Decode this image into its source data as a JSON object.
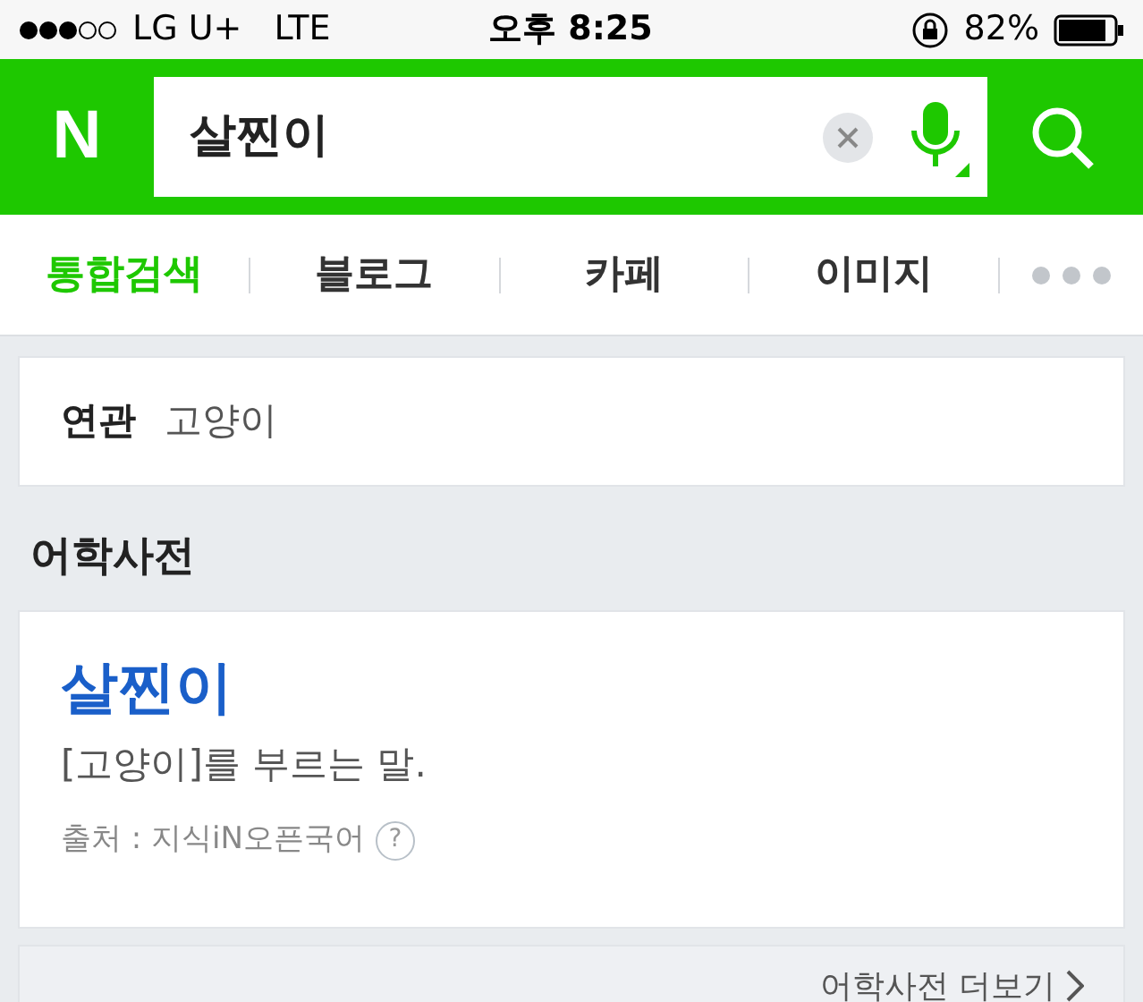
{
  "status_bar": {
    "carrier": "LG U+",
    "network": "LTE",
    "time": "오후 8:25",
    "battery": "82%"
  },
  "search": {
    "logo": "N",
    "query": "살찐이"
  },
  "tabs": [
    {
      "label": "통합검색",
      "selected": true
    },
    {
      "label": "블로그",
      "selected": false
    },
    {
      "label": "카페",
      "selected": false
    },
    {
      "label": "이미지",
      "selected": false
    }
  ],
  "related": {
    "label": "연관",
    "keyword": "고양이"
  },
  "section_title": "어학사전",
  "dictionary": {
    "word": "살찐이",
    "definition": "[고양이]를 부르는 말.",
    "source": "출처 : 지식iN오픈국어",
    "help": "?"
  },
  "more_link": "어학사전 더보기"
}
